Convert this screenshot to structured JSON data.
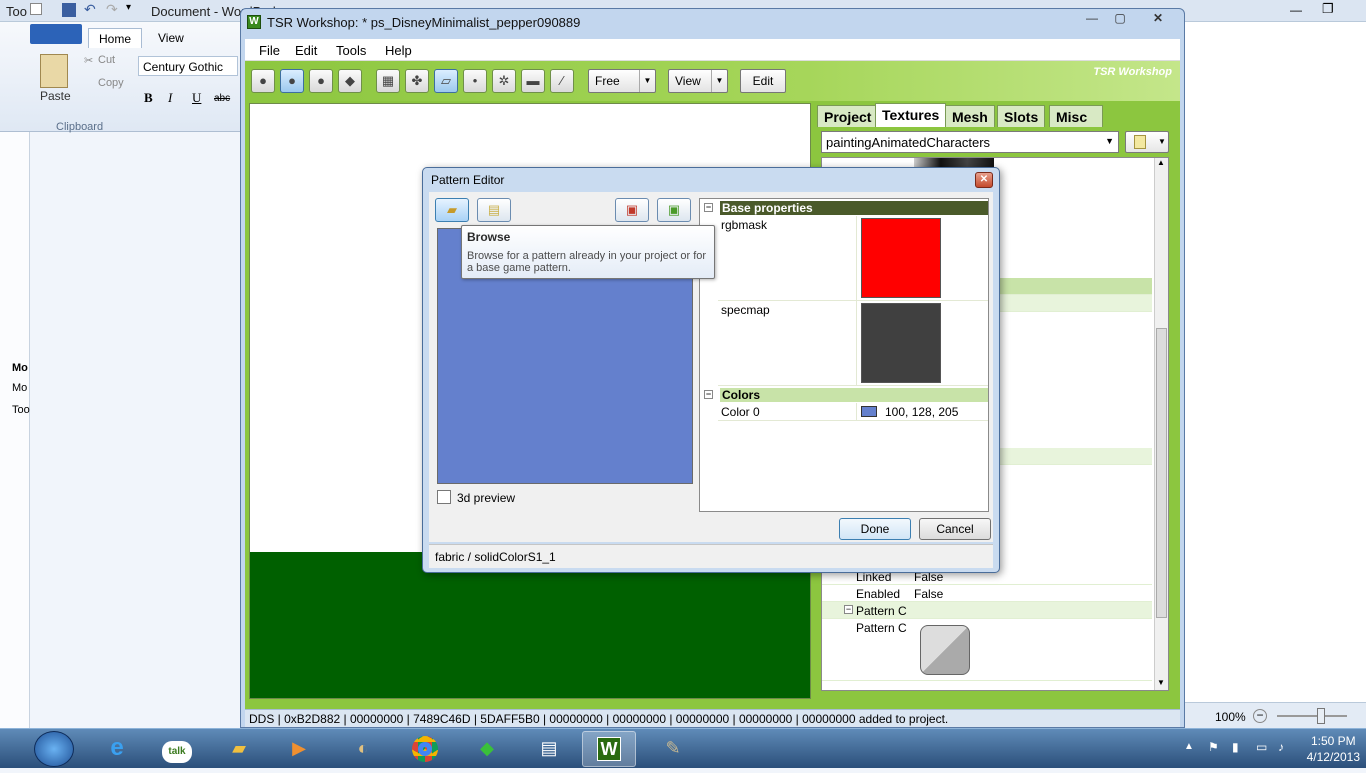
{
  "wordpad": {
    "title": "Document - WordPad",
    "left_title": "Too",
    "tabs": [
      "Home",
      "View"
    ],
    "font_name": "Century Gothic",
    "clipboard": {
      "paste": "Paste",
      "cut": "Cut",
      "copy": "Copy",
      "group_label": "Clipboard"
    },
    "format_buttons": [
      "B",
      "I",
      "U",
      "abc"
    ],
    "left_labels": [
      "Mo",
      "Mo",
      "Too"
    ],
    "zoom": "100%"
  },
  "tsr": {
    "title": "TSR Workshop: * ps_DisneyMinimalist_pepper090889",
    "menu": [
      "File",
      "Edit",
      "Tools",
      "Help"
    ],
    "toolbar": {
      "free_dropdown": "Free",
      "view_dropdown": "View",
      "edit_button": "Edit",
      "brand": "TSR Workshop"
    },
    "right_tabs": [
      "Project",
      "Textures",
      "Mesh",
      "Slots",
      "Misc"
    ],
    "active_tab": "Textures",
    "combo_value": "paintingAnimatedCharacters",
    "grid_rows": [
      {
        "key": "Linked",
        "value": "False"
      },
      {
        "key": "Enabled",
        "value": "False"
      },
      {
        "key": "Pattern C",
        "value": ""
      },
      {
        "key": "Pattern C",
        "value": ""
      }
    ],
    "status": "DDS | 0xB2D882 | 00000000 | 7489C46D | 5DAFF5B0 | 00000000 | 00000000 | 00000000 | 00000000 | 00000000 added to project."
  },
  "dialog": {
    "title": "Pattern Editor",
    "preview_checkbox": "3d preview",
    "categories": {
      "base": "Base properties",
      "colors": "Colors"
    },
    "rows": {
      "rgbmask": {
        "label": "rgbmask",
        "color": "#ff0000"
      },
      "specmap": {
        "label": "specmap",
        "color": "#404040"
      },
      "color0": {
        "label": "Color 0",
        "value": "100, 128, 205",
        "color": "#6480cd"
      }
    },
    "buttons": {
      "done": "Done",
      "cancel": "Cancel"
    },
    "status": "fabric / solidColorS1_1",
    "tooltip": {
      "title": "Browse",
      "text": "Browse for a pattern already in your project or for a base game pattern."
    }
  },
  "taskbar": {
    "items": [
      "ie",
      "talk",
      "explorer",
      "media",
      "paint",
      "chrome",
      "sims",
      "wordpad",
      "tsr",
      "gimp"
    ],
    "active": "tsr",
    "time": "1:50 PM",
    "date": "4/12/2013"
  }
}
